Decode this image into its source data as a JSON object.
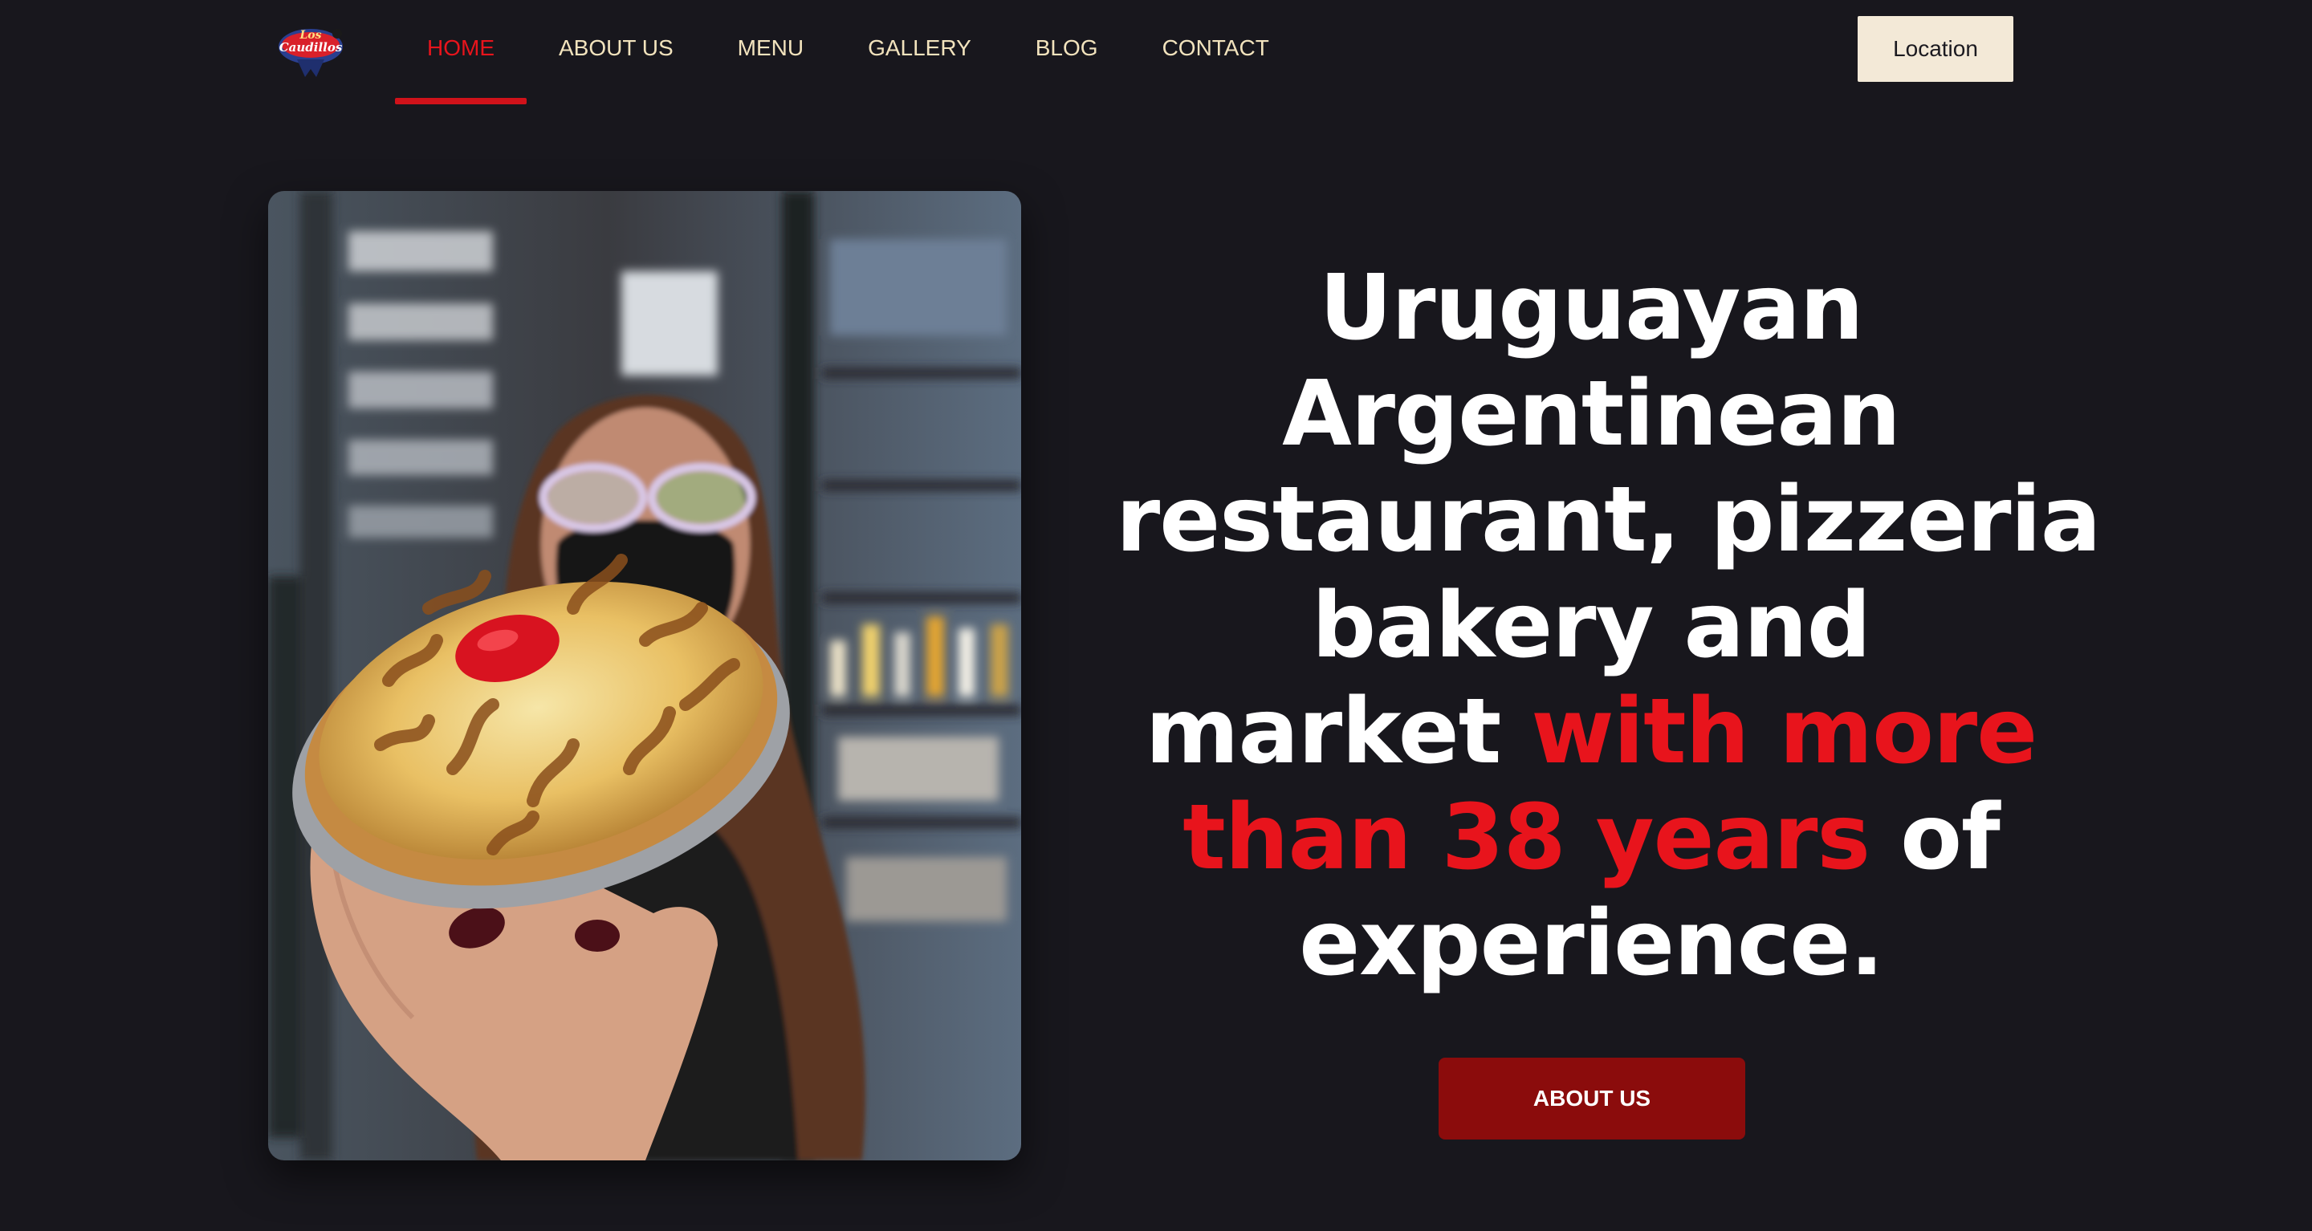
{
  "brand": {
    "logo_text_top": "Los",
    "logo_text_bottom": "Caudillos"
  },
  "nav": {
    "items": [
      {
        "label": "HOME",
        "active": true
      },
      {
        "label": "ABOUT US",
        "active": false
      },
      {
        "label": "MENU",
        "active": false
      },
      {
        "label": "GALLERY",
        "active": false
      },
      {
        "label": "BLOG",
        "active": false
      },
      {
        "label": "CONTACT",
        "active": false
      }
    ],
    "location_label": "Location"
  },
  "hero": {
    "line1": "Uruguayan",
    "line2": "Argentinean",
    "line3": "restaurant, pizzeria",
    "line4": "bakery and",
    "line5_plain": "market ",
    "line5_highlight": "with more",
    "line6_highlight": "than 38 years",
    "line6_plain": " of",
    "line7": "experience.",
    "cta_label": "ABOUT US"
  },
  "colors": {
    "background": "#18171d",
    "accent_red": "#e8141c",
    "nav_text": "#f2e3bd",
    "location_bg": "#f3e9d7",
    "cta_bg": "#8b0c0c"
  }
}
